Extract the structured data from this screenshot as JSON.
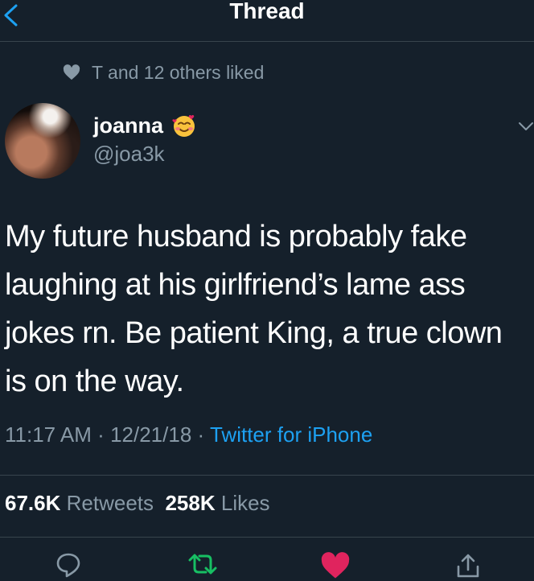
{
  "nav": {
    "title": "Thread",
    "back_icon": "chevron-left-icon",
    "accent_color": "#1da1f2"
  },
  "social_context": {
    "icon": "heart-icon",
    "text": "T and 12 others liked"
  },
  "author": {
    "name": "joanna",
    "emoji": "smiling-face-with-hearts-emoji",
    "handle": "@joa3k"
  },
  "tweet": {
    "text": "My future husband is probably fake laughing at his girlfriend’s lame ass jokes rn. Be patient King, a true clown is on the way.",
    "time": "11:17 AM",
    "date": "12/21/18",
    "separator": "·",
    "source": "Twitter for iPhone"
  },
  "stats": {
    "retweets_count": "67.6K",
    "retweets_label": "Retweets",
    "likes_count": "258K",
    "likes_label": "Likes"
  },
  "actions": {
    "reply_icon": "reply-icon",
    "retweet_icon": "retweet-icon",
    "like_icon": "heart-filled-icon",
    "share_icon": "share-icon",
    "retweet_color": "#17bf63",
    "like_color": "#e0245e"
  },
  "colors": {
    "background": "#15202b",
    "secondary_text": "#8899a6",
    "divider": "#38444d"
  }
}
